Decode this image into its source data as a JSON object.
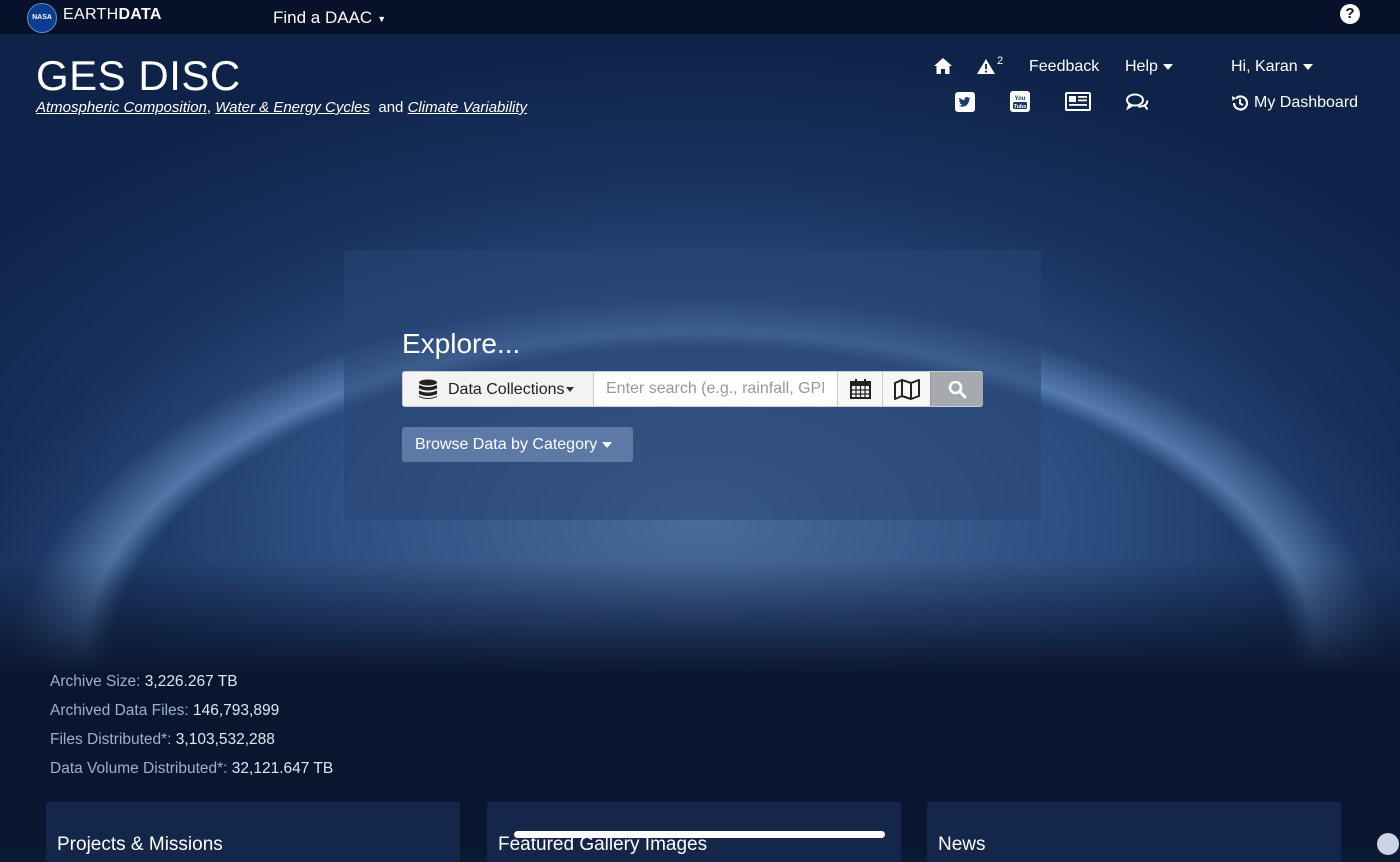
{
  "topbar": {
    "logo_text": "NASA",
    "brand_light": "EARTH",
    "brand_bold": "DATA",
    "find_daac": "Find a DAAC",
    "help_icon": "question-circle-icon"
  },
  "header": {
    "title": "GES DISC",
    "tagline_link1": "Atmospheric Composition",
    "tagline_sep": ",",
    "tagline_link2": "Water & Energy Cycles",
    "tagline_and": "and",
    "tagline_link3": "Climate Variability"
  },
  "nav": {
    "home_icon": "home-icon",
    "alert_icon": "warning-icon",
    "alert_count": "2",
    "feedback": "Feedback",
    "help": "Help",
    "user": "Hi, Karan",
    "dashboard": "My Dashboard",
    "social_icons": [
      "twitter-icon",
      "youtube-icon",
      "newspaper-icon",
      "comments-icon"
    ]
  },
  "search": {
    "heading": "Explore...",
    "collection_label": "Data Collections",
    "placeholder": "Enter search (e.g., rainfall, GPM)",
    "browse_label": "Browse Data by Category"
  },
  "stats": [
    {
      "label": "Archive Size:",
      "value": "3,226.267 TB"
    },
    {
      "label": "Archived Data Files:",
      "value": "146,793,899"
    },
    {
      "label": "Files Distributed*:",
      "value": "3,103,532,288"
    },
    {
      "label": "Data Volume Distributed*:",
      "value": "32,121.647 TB"
    }
  ],
  "cards": [
    "Projects & Missions",
    "Featured Gallery Images",
    "News"
  ],
  "colors": {
    "topbar": "#07122a",
    "panel": "#284673",
    "browse": "#5d7aa7"
  }
}
